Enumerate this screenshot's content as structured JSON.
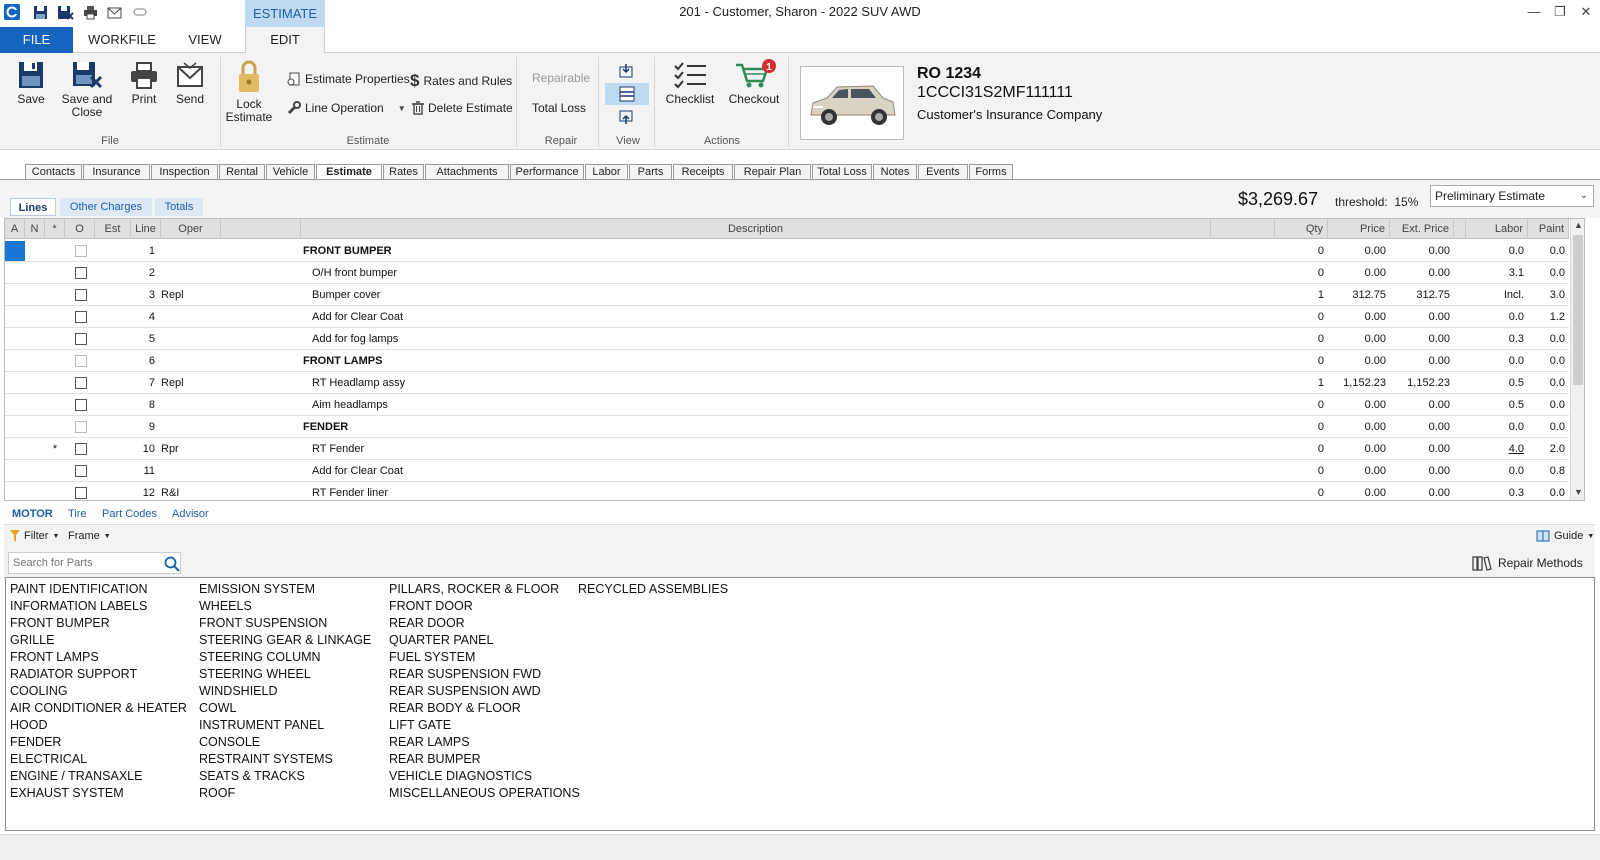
{
  "window": {
    "title": "201 - Customer, Sharon - 2022 SUV AWD",
    "context_tab": "ESTIMATE"
  },
  "menu": {
    "file": "FILE",
    "workfile": "WORKFILE",
    "view": "VIEW",
    "edit": "EDIT"
  },
  "ribbon": {
    "save": "Save",
    "save_close_1": "Save and",
    "save_close_2": "Close",
    "print": "Print",
    "send": "Send",
    "file_group": "File",
    "lock_1": "Lock",
    "lock_2": "Estimate",
    "estimate_properties": "Estimate Properties",
    "line_operation": "Line Operation",
    "rates_rules": "Rates and Rules",
    "delete_estimate": "Delete Estimate",
    "estimate_group": "Estimate",
    "repairable": "Repairable",
    "total_loss": "Total Loss",
    "repair_group": "Repair",
    "view_group": "View",
    "checklist": "Checklist",
    "checkout": "Checkout",
    "checkout_badge": "1",
    "actions_group": "Actions"
  },
  "vehicle": {
    "ro": "RO 1234",
    "vin": "1CCCI31S2MF111111",
    "insurance": "Customer's Insurance Company"
  },
  "tabs": [
    "Contacts",
    "Insurance",
    "Inspection",
    "Rental",
    "Vehicle",
    "Estimate",
    "Rates",
    "Attachments",
    "Performance",
    "Labor",
    "Parts",
    "Receipts",
    "Repair Plan",
    "Total Loss",
    "Notes",
    "Events",
    "Forms"
  ],
  "subtabs": {
    "lines": "Lines",
    "other": "Other Charges",
    "totals": "Totals"
  },
  "summary": {
    "total": "$3,269.67",
    "threshold_label": "threshold:",
    "threshold_value": "15%",
    "estimate_type": "Preliminary Estimate"
  },
  "grid": {
    "headers": {
      "a": "A",
      "n": "N",
      "star": "*",
      "o": "O",
      "est": "Est",
      "line": "Line",
      "oper": "Oper",
      "desc": "Description",
      "qty": "Qty",
      "price": "Price",
      "ext": "Ext. Price",
      "labor": "Labor",
      "paint": "Paint"
    },
    "rows": [
      {
        "star": "",
        "line": "1",
        "oper": "",
        "desc": "FRONT BUMPER",
        "header": true,
        "qty": "0",
        "price": "0.00",
        "ext": "0.00",
        "labor": "0.0",
        "paint": "0.0"
      },
      {
        "star": "",
        "line": "2",
        "oper": "",
        "desc": "O/H front bumper",
        "header": false,
        "qty": "0",
        "price": "0.00",
        "ext": "0.00",
        "labor": "3.1",
        "paint": "0.0"
      },
      {
        "star": "",
        "line": "3",
        "oper": "Repl",
        "desc": "Bumper cover",
        "header": false,
        "qty": "1",
        "price": "312.75",
        "ext": "312.75",
        "labor": "Incl.",
        "paint": "3.0"
      },
      {
        "star": "",
        "line": "4",
        "oper": "",
        "desc": "Add for Clear Coat",
        "header": false,
        "qty": "0",
        "price": "0.00",
        "ext": "0.00",
        "labor": "0.0",
        "paint": "1.2"
      },
      {
        "star": "",
        "line": "5",
        "oper": "",
        "desc": "Add for fog lamps",
        "header": false,
        "qty": "0",
        "price": "0.00",
        "ext": "0.00",
        "labor": "0.3",
        "paint": "0.0"
      },
      {
        "star": "",
        "line": "6",
        "oper": "",
        "desc": "FRONT LAMPS",
        "header": true,
        "qty": "0",
        "price": "0.00",
        "ext": "0.00",
        "labor": "0.0",
        "paint": "0.0"
      },
      {
        "star": "",
        "line": "7",
        "oper": "Repl",
        "desc": "RT Headlamp assy",
        "header": false,
        "qty": "1",
        "price": "1,152.23",
        "ext": "1,152.23",
        "labor": "0.5",
        "paint": "0.0"
      },
      {
        "star": "",
        "line": "8",
        "oper": "",
        "desc": "Aim headlamps",
        "header": false,
        "qty": "0",
        "price": "0.00",
        "ext": "0.00",
        "labor": "0.5",
        "paint": "0.0"
      },
      {
        "star": "",
        "line": "9",
        "oper": "",
        "desc": "FENDER",
        "header": true,
        "qty": "0",
        "price": "0.00",
        "ext": "0.00",
        "labor": "0.0",
        "paint": "0.0"
      },
      {
        "star": "*",
        "line": "10",
        "oper": "Rpr",
        "desc": "RT Fender",
        "header": false,
        "qty": "0",
        "price": "0.00",
        "ext": "0.00",
        "labor": "4.0",
        "paint": "2.0"
      },
      {
        "star": "",
        "line": "11",
        "oper": "",
        "desc": "Add for Clear Coat",
        "header": false,
        "qty": "0",
        "price": "0.00",
        "ext": "0.00",
        "labor": "0.0",
        "paint": "0.8"
      },
      {
        "star": "",
        "line": "12",
        "oper": "R&I",
        "desc": "RT Fender liner",
        "header": false,
        "qty": "0",
        "price": "0.00",
        "ext": "0.00",
        "labor": "0.3",
        "paint": "0.0"
      }
    ]
  },
  "panel": {
    "tabs": [
      "MOTOR",
      "Tire",
      "Part Codes",
      "Advisor"
    ],
    "filter": "Filter",
    "frame": "Frame",
    "guide": "Guide",
    "search_placeholder": "Search for Parts",
    "repair_methods": "Repair Methods"
  },
  "parts": {
    "col1": [
      "PAINT IDENTIFICATION",
      "INFORMATION LABELS",
      "FRONT BUMPER",
      "GRILLE",
      "FRONT LAMPS",
      "RADIATOR SUPPORT",
      "COOLING",
      "AIR CONDITIONER & HEATER",
      "HOOD",
      "FENDER",
      "ELECTRICAL",
      "ENGINE / TRANSAXLE",
      "EXHAUST SYSTEM"
    ],
    "col2": [
      "EMISSION SYSTEM",
      "WHEELS",
      "FRONT SUSPENSION",
      "STEERING GEAR & LINKAGE",
      "STEERING COLUMN",
      "STEERING WHEEL",
      "WINDSHIELD",
      "COWL",
      "INSTRUMENT PANEL",
      "CONSOLE",
      "RESTRAINT SYSTEMS",
      "SEATS & TRACKS",
      "ROOF"
    ],
    "col3": [
      "PILLARS, ROCKER & FLOOR",
      "FRONT DOOR",
      "REAR DOOR",
      "QUARTER PANEL",
      "FUEL SYSTEM",
      "REAR SUSPENSION FWD",
      "REAR SUSPENSION AWD",
      "REAR BODY & FLOOR",
      "LIFT GATE",
      "REAR LAMPS",
      "REAR BUMPER",
      "VEHICLE DIAGNOSTICS",
      "MISCELLANEOUS OPERATIONS"
    ],
    "col4": [
      "RECYCLED ASSEMBLIES"
    ]
  },
  "colors": {
    "accent": "#1565c0",
    "selection": "#1976d2",
    "badge": "#d32f2f"
  }
}
